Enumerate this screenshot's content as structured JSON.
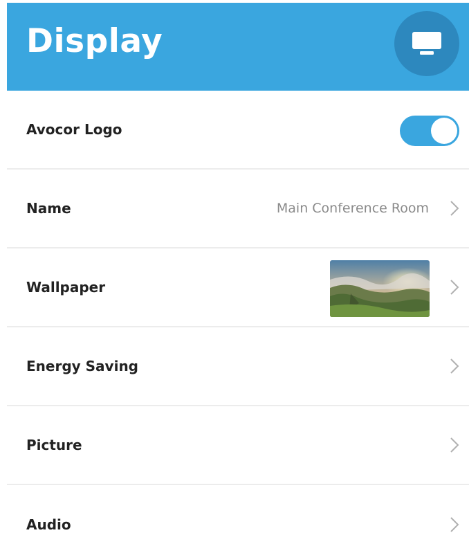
{
  "header": {
    "title": "Display",
    "icon": "monitor-icon",
    "background_color": "#3aa6df",
    "icon_circle_color": "#2d88be"
  },
  "rows": [
    {
      "label": "Avocor Logo",
      "control": "toggle",
      "toggle_on": true
    },
    {
      "label": "Name",
      "value": "Main Conference Room",
      "chevron": true
    },
    {
      "label": "Wallpaper",
      "thumbnail": "landscape-wallpaper-thumbnail",
      "chevron": true
    },
    {
      "label": "Energy Saving",
      "chevron": true
    },
    {
      "label": "Picture",
      "chevron": true
    },
    {
      "label": "Audio",
      "chevron": true
    }
  ],
  "colors": {
    "accent": "#3aa6df",
    "label_text": "#222222",
    "value_text": "#8a8a8a",
    "divider": "#ececec",
    "chevron": "#b0b0b0"
  }
}
